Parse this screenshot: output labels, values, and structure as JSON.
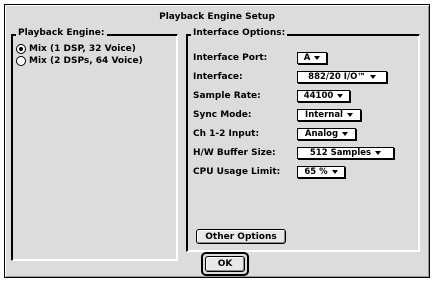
{
  "dialog": {
    "title": "Playback Engine Setup"
  },
  "playback_engine": {
    "legend": "Playback Engine:",
    "options": [
      {
        "label": "Mix (1 DSP, 32 Voice)",
        "selected": true
      },
      {
        "label": "Mix (2 DSPs, 64 Voice)",
        "selected": false
      }
    ]
  },
  "interface_options": {
    "legend": "Interface Options:",
    "rows": [
      {
        "label": "Interface Port:",
        "value": "A"
      },
      {
        "label": "Interface:",
        "value": "882/20 I/O™"
      },
      {
        "label": "Sample Rate:",
        "value": "44100"
      },
      {
        "label": "Sync Mode:",
        "value": "Internal"
      },
      {
        "label": "Ch 1-2 Input:",
        "value": "Analog"
      },
      {
        "label": "H/W Buffer Size:",
        "value": "512 Samples"
      },
      {
        "label": "CPU Usage Limit:",
        "value": "65 %"
      }
    ],
    "other_options_label": "Other Options"
  },
  "footer": {
    "ok_label": "OK"
  },
  "icons": {
    "popup_arrow": "triangle-down-icon",
    "radio": "radio-icon"
  }
}
